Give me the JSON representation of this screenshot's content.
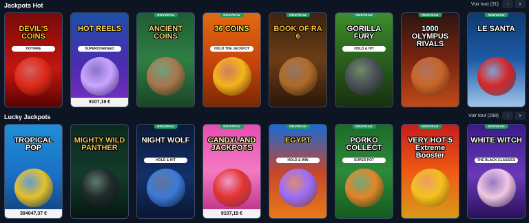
{
  "sections": [
    {
      "title": "Jackpots Hot",
      "view_all": "Voir tout (31)",
      "prev": "‹",
      "next": "›",
      "games": [
        {
          "name": "DEVIL'S COINS",
          "sub": "HOTFIRE",
          "badge": "",
          "jackpot": "",
          "bg": "linear-gradient(180deg,#7a0a0a,#c4160f 60%,#5a0303)",
          "title_color": "#ffcc22",
          "art": "#e02a1a"
        },
        {
          "name": "HOT REELS",
          "sub": "SUPERCHARGED",
          "badge": "",
          "jackpot": "9107,19 €",
          "bg": "linear-gradient(180deg,#1d4fa8,#4a2bb0 55%,#7a2fbf)",
          "title_color": "#ffd84a",
          "art": "#c9a6ff"
        },
        {
          "name": "ANCIENT COINS",
          "sub": "",
          "badge": "NOUVEAU",
          "jackpot": "",
          "bg": "linear-gradient(180deg,#1f5d33,#2f7e45 50%,#1b4426)",
          "title_color": "#f4d27a",
          "art": "#a9774a"
        },
        {
          "name": "36 COINS",
          "sub": "HOLD THE JACKPOT",
          "badge": "NOUVEAU",
          "jackpot": "",
          "bg": "linear-gradient(180deg,#e26a12,#c5420a 55%,#7a2906)",
          "title_color": "#ffe34a",
          "art": "#f3b51c"
        },
        {
          "name": "BOOK OF RA 6",
          "sub": "",
          "badge": "NOUVEAU",
          "jackpot": "",
          "bg": "linear-gradient(180deg,#3d2410,#6b3d16 50%,#2a170a)",
          "title_color": "#f2c03d",
          "art": "#b06a2a"
        },
        {
          "name": "GORILLA FURY",
          "sub": "HOLD & HIT",
          "badge": "NOUVEAU",
          "jackpot": "",
          "bg": "linear-gradient(180deg,#3d8d2c,#285a1c 55%,#16300f)",
          "title_color": "#ffffff",
          "art": "#4b4f57"
        },
        {
          "name": "1000 OLYMPUS RIVALS",
          "sub": "",
          "badge": "NOUVEAU",
          "jackpot": "",
          "bg": "linear-gradient(180deg,#2a1612,#7a2410 50%,#c04a18)",
          "title_color": "#ffffff",
          "art": "#c7652a"
        },
        {
          "name": "LE SANTA",
          "sub": "",
          "badge": "NOUVEAU",
          "jackpot": "",
          "bg": "linear-gradient(180deg,#0f3a70,#1e5ba6 50%,#9fc4ea)",
          "title_color": "#ffffff",
          "art": "#d8262a"
        }
      ]
    },
    {
      "title": "Lucky Jackpots",
      "view_all": "Voir tout (288)",
      "prev": "‹",
      "next": "›",
      "games": [
        {
          "name": "TROPICAL POP",
          "sub": "",
          "badge": "",
          "jackpot": "384047,37 €",
          "bg": "linear-gradient(180deg,#1f8fd6,#1a6fc4 55%,#0f3f7a)",
          "title_color": "#ffffff",
          "art": "#e6c12a"
        },
        {
          "name": "MIGHTY WILD PANTHER",
          "sub": "",
          "badge": "",
          "jackpot": "",
          "bg": "linear-gradient(180deg,#0c2a1e,#123b2a 55%,#07160f)",
          "title_color": "#f0c24a",
          "art": "#1e2a2a"
        },
        {
          "name": "NIGHT WOLF",
          "sub": "HOLD & HIT",
          "badge": "NOUVEAU",
          "jackpot": "",
          "bg": "linear-gradient(180deg,#0b1a3a,#13306a 55%,#0a1733)",
          "title_color": "#ffffff",
          "art": "#3c7bd8"
        },
        {
          "name": "CANDYLAND JACKPOTS",
          "sub": "",
          "badge": "NOUVEAU",
          "jackpot": "9107,19 €",
          "bg": "linear-gradient(180deg,#e84db0,#f27ac2 50%,#b8277f)",
          "title_color": "#fff4a3",
          "art": "#e2342e"
        },
        {
          "name": "EGYPT",
          "sub": "HOLD & WIN",
          "badge": "NOUVEAU",
          "jackpot": "",
          "bg": "linear-gradient(180deg,#1a6bd6,#c4462c 50%,#e87a16)",
          "title_color": "#ffd84a",
          "art": "#9b6cff"
        },
        {
          "name": "PORKO COLLECT",
          "sub": "SUPER POT",
          "badge": "NOUVEAU",
          "jackpot": "",
          "bg": "linear-gradient(180deg,#1d6b2a,#2c8a3a 50%,#145a20)",
          "title_color": "#ffffff",
          "art": "#e3852a"
        },
        {
          "name": "VERY HOT 5 Extreme Booster",
          "sub": "",
          "badge": "NOUVEAU",
          "jackpot": "",
          "bg": "linear-gradient(180deg,#c81d1d,#ef5a14 50%,#d89a1a)",
          "title_color": "#ffffff",
          "art": "#f2c21c"
        },
        {
          "name": "WHITE WITCH",
          "sub": "THE BLACK CLASSICS",
          "badge": "NOUVEAU",
          "jackpot": "",
          "bg": "linear-gradient(180deg,#3a1a8a,#6a3ab8 55%,#2a0f5a)",
          "title_color": "#ffffff",
          "art": "#f1c9e4"
        }
      ]
    }
  ]
}
